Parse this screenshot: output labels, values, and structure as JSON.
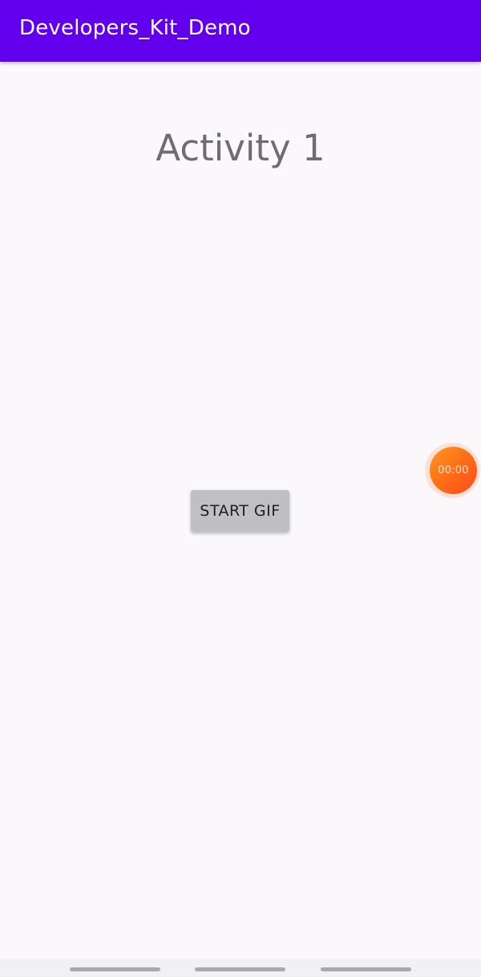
{
  "app_bar": {
    "title": "Developers_Kit_Demo",
    "color": "#6200ee"
  },
  "main": {
    "heading": "Activity 1",
    "start_button_label": "START GIF"
  },
  "timer_bubble": {
    "time": "00:00",
    "color": "#ff6a14"
  },
  "nav_bar": {
    "pills": [
      "left-pill",
      "center-pill",
      "right-pill"
    ]
  }
}
